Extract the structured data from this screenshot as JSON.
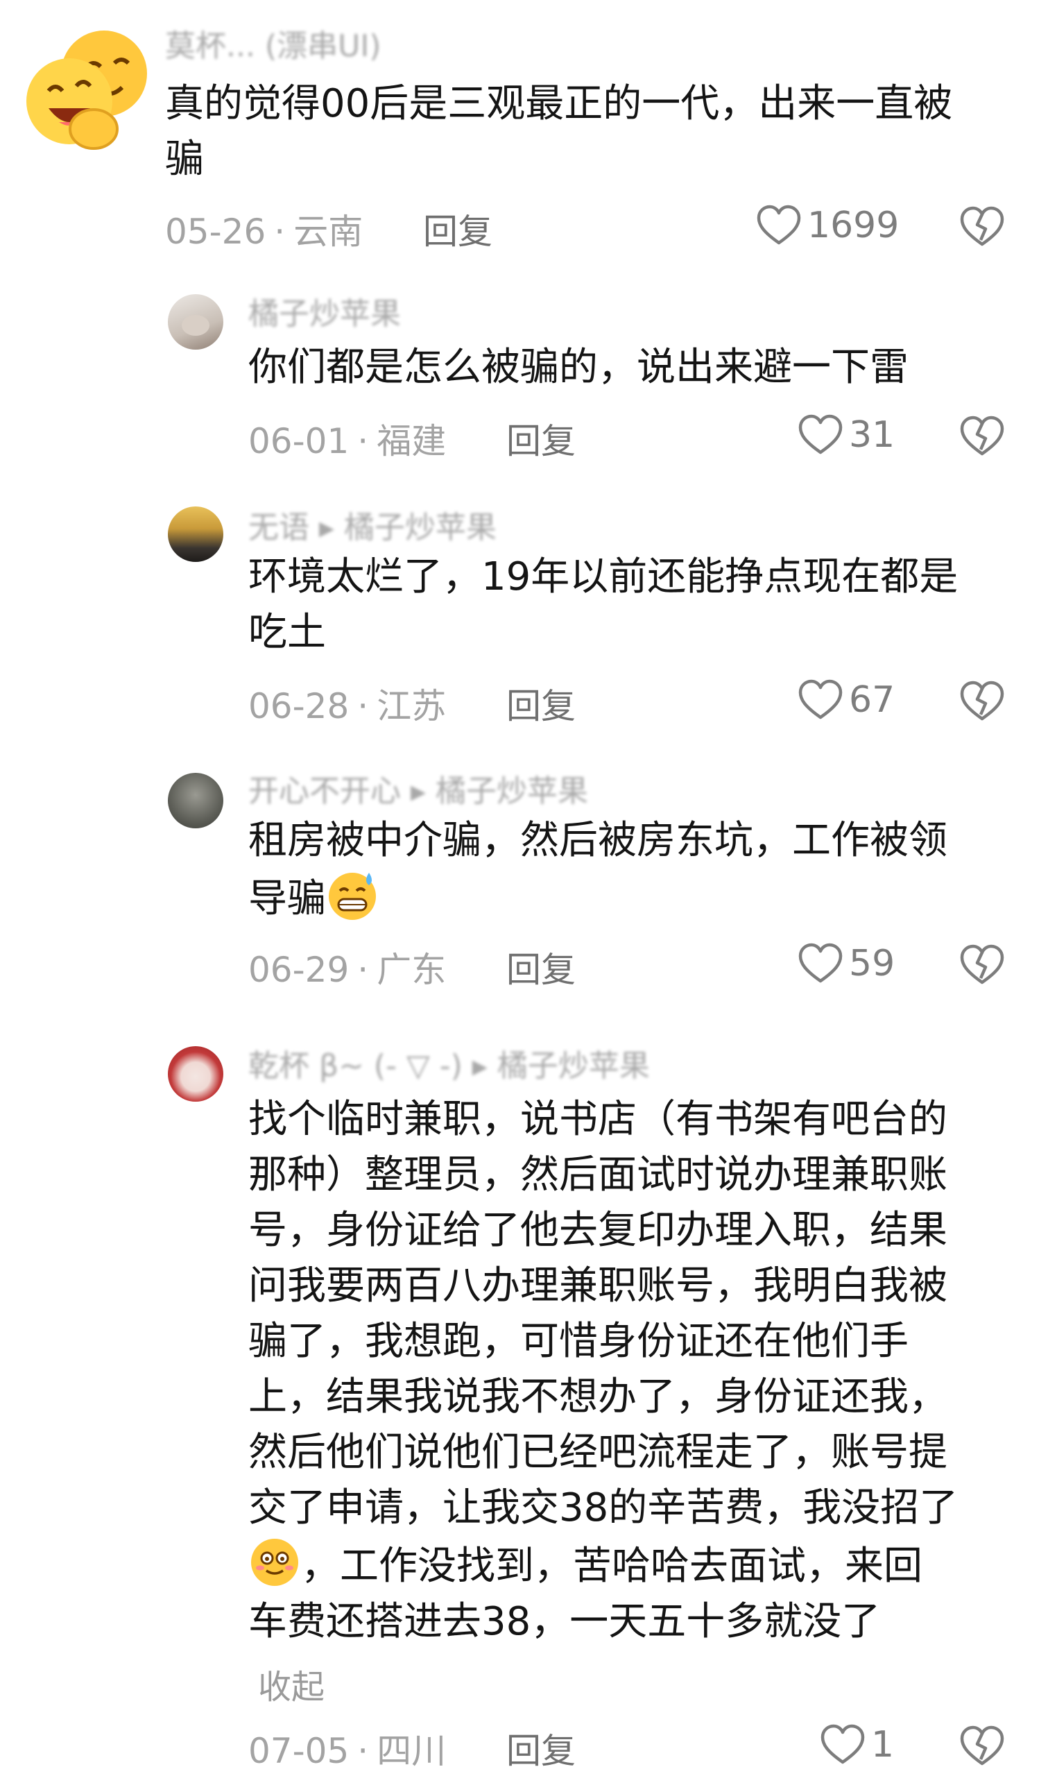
{
  "comments": [
    {
      "user": "莫杯... (漂串UI)",
      "text_lines": [
        "真的觉得00后是三观最正的一代，出来一直被",
        "骗"
      ],
      "date": "05-26",
      "region": "云南",
      "reply_label": "回复",
      "likes": "1699"
    },
    {
      "user": "橘子炒苹果",
      "text_lines": [
        "你们都是怎么被骗的，说出来避一下雷"
      ],
      "date": "06-01",
      "region": "福建",
      "reply_label": "回复",
      "likes": "31"
    },
    {
      "user": "无语 ▸ 橘子炒苹果",
      "text_lines": [
        "环境太烂了，19年以前还能挣点现在都是",
        "吃土"
      ],
      "date": "06-28",
      "region": "江苏",
      "reply_label": "回复",
      "likes": "67"
    },
    {
      "user": "开心不开心 ▸ 橘子炒苹果",
      "text_lines": [
        "租房被中介骗，然后被房东坑，工作被领",
        "导骗"
      ],
      "date": "06-29",
      "region": "广东",
      "reply_label": "回复",
      "likes": "59"
    },
    {
      "user": "乾杯 β~ (- ▽ -) ▸ 橘子炒苹果",
      "text_lines": [
        "找个临时兼职，说书店（有书架有吧台的",
        "那种）整理员，然后面试时说办理兼职账",
        "号，身份证给了他去复印办理入职，结果",
        "问我要两百八办理兼职账号，我明白我被",
        "骗了，我想跑，可惜身份证还在他们手",
        "上，结果我说我不想办了，身份证还我，",
        "然后他们说他们已经吧流程走了，账号提",
        "交了申请，让我交38的辛苦费，我没招了",
        "，工作没找到，苦哈哈去面试，来回",
        "车费还搭进去38，一天五十多就没了"
      ],
      "collapse_label": "收起",
      "date": "07-05",
      "region": "四川",
      "reply_label": "回复",
      "likes": "1"
    }
  ],
  "meta_separator": "·",
  "icons": {
    "like": "heart-outline-icon",
    "dislike": "broken-heart-icon"
  },
  "colors": {
    "text": "#141414",
    "meta": "#a3a3a3",
    "reply": "#6f6f6f",
    "icon": "#7d7d7d"
  }
}
